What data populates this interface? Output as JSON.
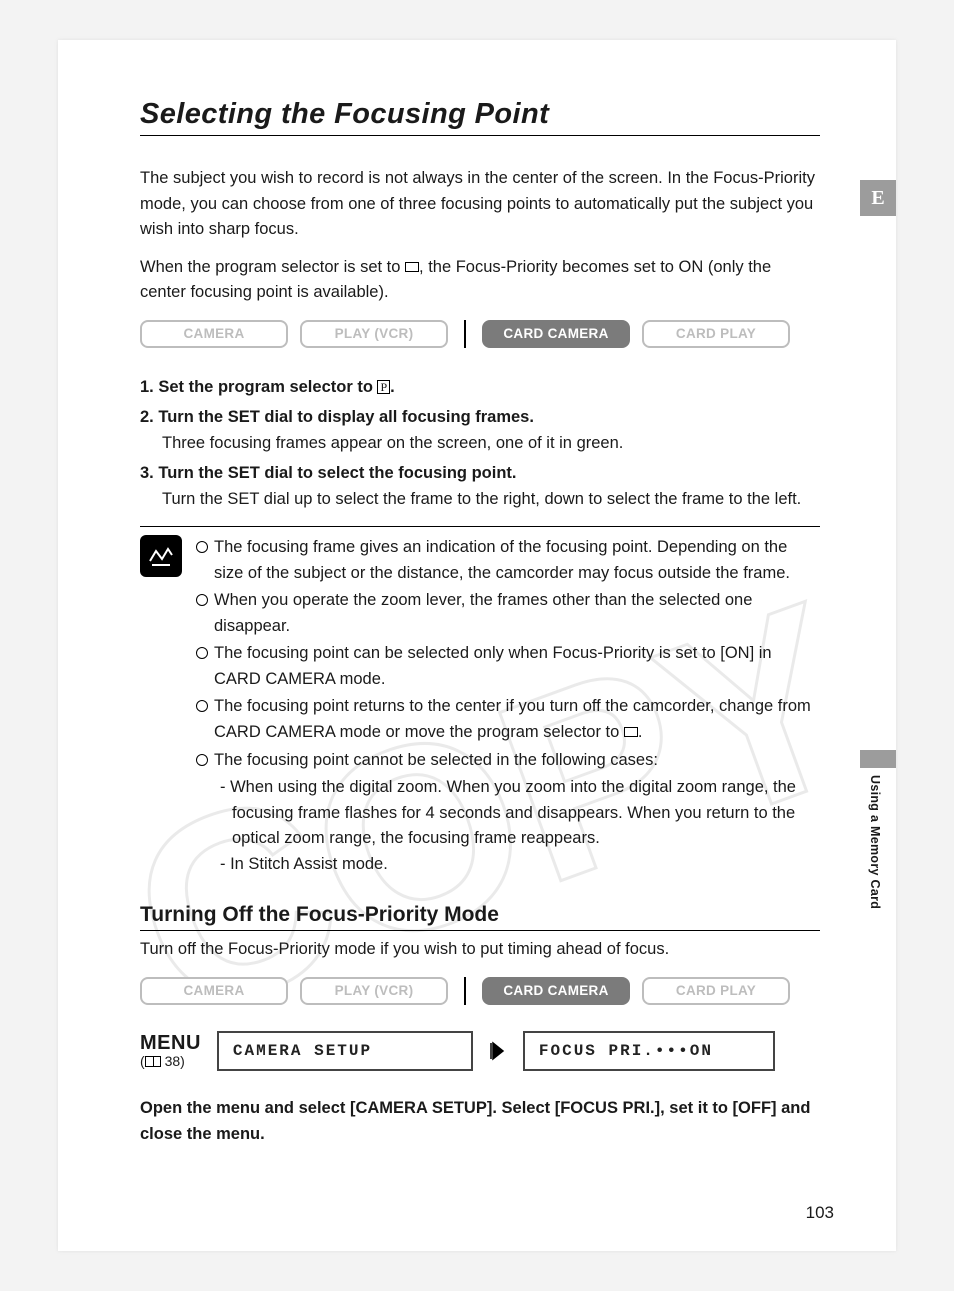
{
  "title": "Selecting the Focusing Point",
  "side_tab": "E",
  "side_label": "Using a Memory Card",
  "page_number": "103",
  "intro": {
    "p1": "The subject you wish to record is not always in the center of the screen. In the Focus-Priority mode, you can choose from one of three focusing points to automatically put the subject you wish into sharp focus.",
    "p2a": "When the program selector is set to ",
    "p2b": ", the Focus-Priority becomes set to ON (only the center focusing point is available)."
  },
  "modes": {
    "camera": "CAMERA",
    "play_vcr": "PLAY (VCR)",
    "card_camera": "CARD CAMERA",
    "card_play": "CARD PLAY"
  },
  "steps": {
    "s1a": "1. Set the program selector to ",
    "s1b": ".",
    "s2": "2. Turn the SET dial to display all focusing frames.",
    "s2_sub": "Three focusing frames appear on the screen, one of it in green.",
    "s3": "3. Turn the SET dial to select the focusing point.",
    "s3_sub": "Turn the SET dial up to select the frame to the right, down to select the frame to the left."
  },
  "notes": {
    "b1": "The focusing frame gives an indication of the focusing point. Depending on the size of the subject or the distance, the camcorder may focus outside the frame.",
    "b2": "When you operate the zoom lever, the frames other than the selected one disappear.",
    "b3": "The focusing point can be selected only when Focus-Priority is set to [ON] in CARD CAMERA mode.",
    "b4a": "The focusing point returns to the center if you turn off the camcorder, change from CARD CAMERA mode or move the program selector to ",
    "b4b": ".",
    "b5": "The focusing point cannot be selected in the following cases:",
    "b5s1": "- When using the digital zoom. When you zoom into the digital zoom range, the focusing frame flashes for 4 seconds and disappears. When you return to the optical zoom range, the focusing frame reappears.",
    "b5s2": "- In Stitch Assist mode."
  },
  "section2": {
    "heading": "Turning Off the Focus-Priority Mode",
    "desc": "Turn off the Focus-Priority mode if you wish to put timing ahead of focus."
  },
  "menu": {
    "label": "MENU",
    "ref": "38",
    "left_box": "CAMERA SETUP",
    "right_box": "FOCUS PRI.•••ON"
  },
  "closing": "Open the menu and select [CAMERA SETUP]. Select [FOCUS PRI.], set it to [OFF] and close the menu."
}
